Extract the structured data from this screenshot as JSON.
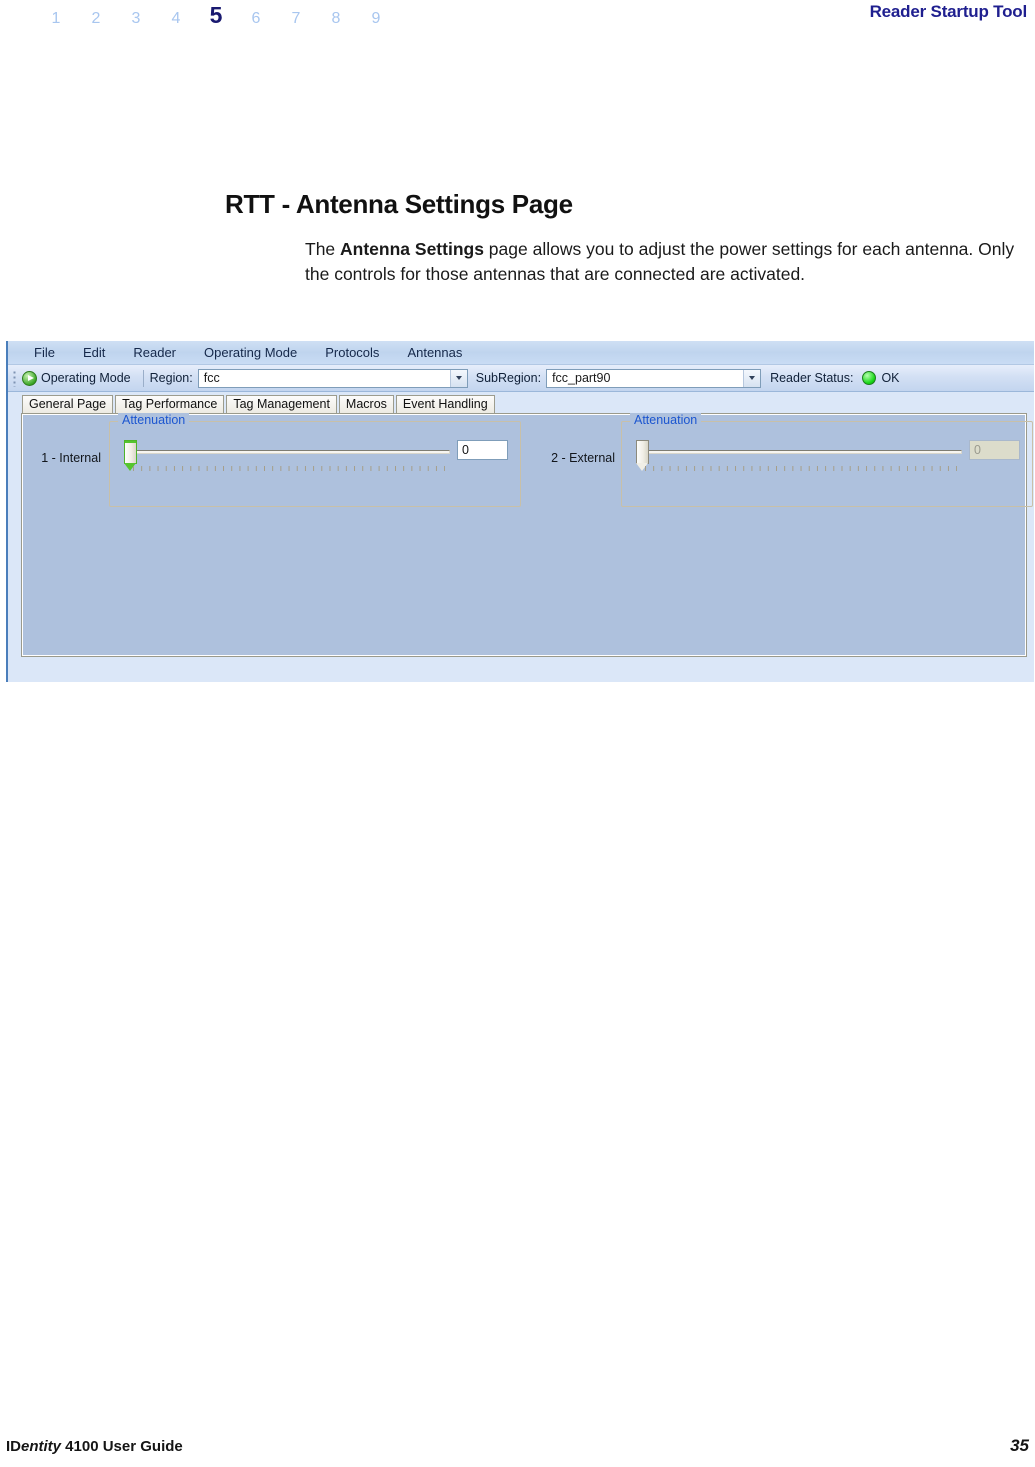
{
  "running_head": {
    "step_numbers": [
      "1",
      "2",
      "3",
      "4",
      "5",
      "6",
      "7",
      "8",
      "9"
    ],
    "current_step": "5",
    "title": "Reader Startup Tool",
    "inactive_color": "#a8c6ef",
    "active_color": "#191970",
    "title_color": "#1f1f8f"
  },
  "section": {
    "heading": "RTT - Antenna Settings Page",
    "paragraph": {
      "lead": "The ",
      "bold": "Antenna Settings",
      "rest": " page allows you to adjust the power settings for each antenna. Only the controls for those antennas that are connected are activated."
    }
  },
  "app": {
    "menubar": {
      "items": [
        {
          "label": "File"
        },
        {
          "label": "Edit"
        },
        {
          "label": "Reader"
        },
        {
          "label": "Operating Mode"
        },
        {
          "label": "Protocols"
        },
        {
          "label": "Antennas"
        }
      ]
    },
    "toolbar": {
      "operating_mode_button": "Operating Mode",
      "play_icon": "play-circle-icon",
      "region_label": "Region:",
      "region_value": "fcc",
      "subregion_label": "SubRegion:",
      "subregion_value": "fcc_part90",
      "reader_status_label": "Reader Status:",
      "reader_status_value": "OK",
      "reader_status_color": "#18d818",
      "dropdown_icon": "chevron-down-icon"
    },
    "tabs": [
      {
        "label": "General Page",
        "selected": true
      },
      {
        "label": "Tag Performance",
        "selected": false
      },
      {
        "label": "Tag Management",
        "selected": false
      },
      {
        "label": "Macros",
        "selected": false
      },
      {
        "label": "Event Handling",
        "selected": false
      }
    ],
    "antennas": [
      {
        "label": "1 - Internal",
        "group_legend": "Attenuation",
        "slider_value": "0",
        "slider_min": "0",
        "value_box": "0",
        "enabled": true
      },
      {
        "label": "2 - External",
        "group_legend": "Attenuation",
        "slider_value": "0",
        "slider_min": "0",
        "value_box": "0",
        "enabled": false
      }
    ]
  },
  "footer": {
    "guide_prefix": "ID",
    "guide_italic": "entity",
    "guide_suffix": " 4100 User Guide",
    "page_number": "35"
  }
}
